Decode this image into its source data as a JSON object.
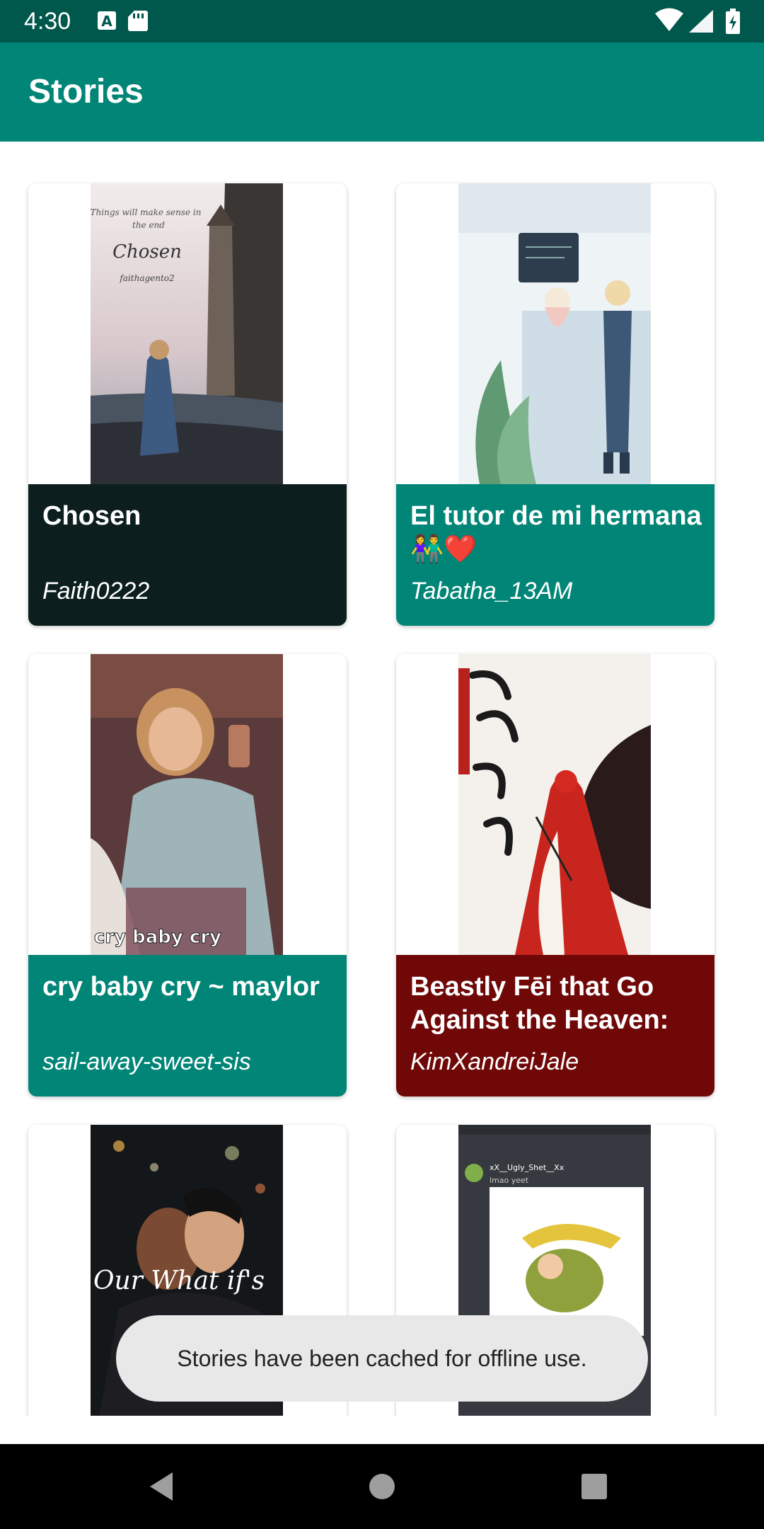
{
  "status_bar": {
    "time": "4:30",
    "left_icons": [
      "a-notification-icon",
      "sd-card-icon"
    ],
    "right_icons": [
      "wifi-icon",
      "signal-icon",
      "battery-icon"
    ]
  },
  "app_bar": {
    "title": "Stories"
  },
  "stories": [
    {
      "title": "Chosen",
      "author": "Faith0222",
      "caption_color": "#0d1e1e",
      "cover_lines": [
        "Things will make sense in",
        "the end",
        "Chosen",
        "faithagento2"
      ]
    },
    {
      "title": "El tutor de mi hermana 👫❤️",
      "author": "Tabatha_13AM",
      "caption_color": "#008577"
    },
    {
      "title": "cry baby cry ~ maylor",
      "author": "sail-away-sweet-sis",
      "caption_color": "#008577",
      "cover_lines": [
        "cry baby cry"
      ]
    },
    {
      "title": "Beastly Fēi that Go Against the Heaven: …",
      "author": "KimXandreiJale",
      "caption_color": "#700808"
    },
    {
      "title": "",
      "author": "",
      "caption_color": "#ffffff",
      "cover_lines": [
        "Our What if's"
      ]
    },
    {
      "title": "",
      "author": "",
      "caption_color": "#ffffff",
      "cover_lines": [
        "xX__Ugly_Shet__Xx",
        "lmao yeet"
      ]
    }
  ],
  "toast": {
    "message": "Stories have been cached for offline use."
  },
  "nav_bar": {
    "buttons": [
      "back-icon",
      "home-icon",
      "recents-icon"
    ]
  }
}
